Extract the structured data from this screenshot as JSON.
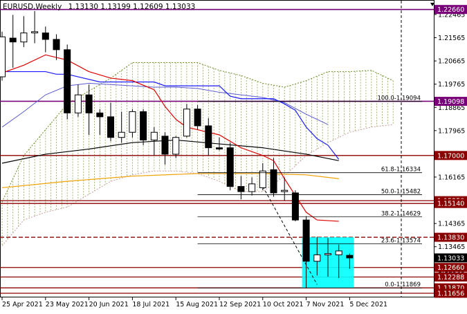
{
  "header": {
    "title": "EURUSD,Weekly",
    "ohlc": "1.13130 1.13199 1.12609 1.13033"
  },
  "colors": {
    "bull": "#ffffff",
    "bear": "#000000",
    "tenkan": "#e00000",
    "kijun": "#1a1aff",
    "chikou": "#5a5ad0",
    "ma_black": "#000000",
    "ma_orange": "#f0a000",
    "cloud_up": "#6b8e23",
    "cloud_down": "#c8a0a0",
    "level": "#8b0000",
    "purple": "#7a007a",
    "cyan": "#00ffff"
  },
  "chart_data": {
    "type": "candlestick",
    "symbol": "EURUSD",
    "timeframe": "Weekly",
    "ylim": [
      1.115,
      1.23
    ],
    "x_ticks": [
      {
        "i": 0,
        "label": "25 Apr 2021"
      },
      {
        "i": 4,
        "label": "23 May 2021"
      },
      {
        "i": 8,
        "label": "20 Jun 2021"
      },
      {
        "i": 12,
        "label": "18 Jul 2021"
      },
      {
        "i": 16,
        "label": "15 Aug 2021"
      },
      {
        "i": 20,
        "label": "12 Sep 2021"
      },
      {
        "i": 24,
        "label": "10 Oct 2021"
      },
      {
        "i": 28,
        "label": "7 Nov 2021"
      },
      {
        "i": 32,
        "label": "5 Dec 2021"
      }
    ],
    "y_ticks": [
      1.22465,
      1.21565,
      1.20665,
      1.19765,
      1.18865,
      1.17965,
      1.17065,
      1.16165,
      1.15265,
      1.14365,
      1.13465,
      1.12565,
      1.11665
    ],
    "candles": [
      {
        "o": 1.2005,
        "h": 1.218,
        "l": 1.199,
        "c": 1.216
      },
      {
        "o": 1.2155,
        "h": 1.2245,
        "l": 1.204,
        "c": 1.214
      },
      {
        "o": 1.214,
        "h": 1.224,
        "l": 1.212,
        "c": 1.2175
      },
      {
        "o": 1.2175,
        "h": 1.226,
        "l": 1.2135,
        "c": 1.218
      },
      {
        "o": 1.2175,
        "h": 1.22,
        "l": 1.21,
        "c": 1.215
      },
      {
        "o": 1.215,
        "h": 1.217,
        "l": 1.207,
        "c": 1.211
      },
      {
        "o": 1.211,
        "h": 1.213,
        "l": 1.184,
        "c": 1.1865
      },
      {
        "o": 1.1865,
        "h": 1.1975,
        "l": 1.185,
        "c": 1.1935
      },
      {
        "o": 1.1935,
        "h": 1.1975,
        "l": 1.178,
        "c": 1.1865
      },
      {
        "o": 1.1865,
        "h": 1.188,
        "l": 1.178,
        "c": 1.185
      },
      {
        "o": 1.185,
        "h": 1.1905,
        "l": 1.1755,
        "c": 1.177
      },
      {
        "o": 1.177,
        "h": 1.187,
        "l": 1.175,
        "c": 1.179
      },
      {
        "o": 1.179,
        "h": 1.188,
        "l": 1.177,
        "c": 1.187
      },
      {
        "o": 1.187,
        "h": 1.188,
        "l": 1.174,
        "c": 1.176
      },
      {
        "o": 1.176,
        "h": 1.181,
        "l": 1.17,
        "c": 1.179
      },
      {
        "o": 1.1775,
        "h": 1.179,
        "l": 1.1665,
        "c": 1.1705
      },
      {
        "o": 1.1705,
        "h": 1.1775,
        "l": 1.169,
        "c": 1.177
      },
      {
        "o": 1.1775,
        "h": 1.19,
        "l": 1.177,
        "c": 1.188
      },
      {
        "o": 1.188,
        "h": 1.1895,
        "l": 1.18,
        "c": 1.1815
      },
      {
        "o": 1.1815,
        "h": 1.1845,
        "l": 1.17,
        "c": 1.173
      },
      {
        "o": 1.173,
        "h": 1.177,
        "l": 1.172,
        "c": 1.1725
      },
      {
        "o": 1.173,
        "h": 1.175,
        "l": 1.1565,
        "c": 1.158
      },
      {
        "o": 1.158,
        "h": 1.162,
        "l": 1.153,
        "c": 1.156
      },
      {
        "o": 1.156,
        "h": 1.1615,
        "l": 1.1545,
        "c": 1.159
      },
      {
        "o": 1.1575,
        "h": 1.167,
        "l": 1.1565,
        "c": 1.164
      },
      {
        "o": 1.1645,
        "h": 1.169,
        "l": 1.154,
        "c": 1.1555
      },
      {
        "o": 1.156,
        "h": 1.1615,
        "l": 1.1525,
        "c": 1.1565
      },
      {
        "o": 1.1555,
        "h": 1.1565,
        "l": 1.1445,
        "c": 1.145
      },
      {
        "o": 1.145,
        "h": 1.1465,
        "l": 1.1185,
        "c": 1.129
      },
      {
        "o": 1.129,
        "h": 1.1385,
        "l": 1.1235,
        "c": 1.1315
      },
      {
        "o": 1.1315,
        "h": 1.138,
        "l": 1.123,
        "c": 1.132
      },
      {
        "o": 1.1315,
        "h": 1.1355,
        "l": 1.1225,
        "c": 1.133
      },
      {
        "o": 1.1313,
        "h": 1.132,
        "l": 1.1261,
        "c": 1.1303
      }
    ],
    "price_tags": [
      {
        "value": 1.2266,
        "label": "1.22660",
        "color": "#7a007a"
      },
      {
        "value": 1.191,
        "label": "1.19098",
        "color": "#7a007a"
      },
      {
        "value": 1.17,
        "label": "1.17000",
        "color": "#8b0000"
      },
      {
        "value": 1.1525,
        "label": "1.15250",
        "color": "#8b0000"
      },
      {
        "value": 1.1514,
        "label": "1.15140",
        "color": "#8b0000"
      },
      {
        "value": 1.1383,
        "label": "1.13830",
        "color": "#8b0000"
      },
      {
        "value": 1.1303,
        "label": "1.13033",
        "color": "#000000"
      },
      {
        "value": 1.1266,
        "label": "1.12660",
        "color": "#8b0000"
      },
      {
        "value": 1.1229,
        "label": "1.12288",
        "color": "#8b0000"
      },
      {
        "value": 1.1187,
        "label": "1.11870",
        "color": "#8b0000"
      },
      {
        "value": 1.1166,
        "label": "1.11656",
        "color": "#8b0000"
      }
    ],
    "fibo_levels": [
      {
        "value": 1.19094,
        "label": "100.0-1.19094"
      },
      {
        "value": 1.16334,
        "label": "61.8-1.16334"
      },
      {
        "value": 1.15482,
        "label": "50.0-1.15482"
      },
      {
        "value": 1.14629,
        "label": "38.2-1.14629"
      },
      {
        "value": 1.13574,
        "label": "23.6-1.13574"
      },
      {
        "value": 1.11869,
        "label": "0.0-1.11869"
      }
    ],
    "tenkan": [
      [
        0,
        1.202
      ],
      [
        2,
        1.205
      ],
      [
        4,
        1.209
      ],
      [
        5,
        1.208
      ],
      [
        6,
        1.207
      ],
      [
        8,
        1.2025
      ],
      [
        10,
        1.2
      ],
      [
        12,
        1.199
      ],
      [
        14,
        1.1955
      ],
      [
        15,
        1.189
      ],
      [
        16,
        1.184
      ],
      [
        17,
        1.181
      ],
      [
        18,
        1.18
      ],
      [
        20,
        1.178
      ],
      [
        22,
        1.173
      ],
      [
        24,
        1.17
      ],
      [
        25,
        1.168
      ],
      [
        26,
        1.161
      ],
      [
        27,
        1.1545
      ],
      [
        28,
        1.148
      ],
      [
        29,
        1.145
      ],
      [
        31,
        1.1445
      ]
    ],
    "kijun": [
      [
        0,
        1.2025
      ],
      [
        4,
        1.2025
      ],
      [
        5,
        1.2015
      ],
      [
        6,
        1.2015
      ],
      [
        9,
        1.1985
      ],
      [
        14,
        1.1985
      ],
      [
        15,
        1.197
      ],
      [
        20,
        1.197
      ],
      [
        21,
        1.193
      ],
      [
        22,
        1.192
      ],
      [
        25,
        1.192
      ],
      [
        26,
        1.19
      ],
      [
        27,
        1.1875
      ],
      [
        28,
        1.181
      ],
      [
        29,
        1.1765
      ],
      [
        30,
        1.174
      ],
      [
        31,
        1.1685
      ]
    ],
    "chikou": [
      [
        0,
        1.181
      ],
      [
        2,
        1.187
      ],
      [
        4,
        1.1935
      ],
      [
        6,
        1.197
      ],
      [
        8,
        1.198
      ],
      [
        10,
        1.1975
      ],
      [
        12,
        1.197
      ],
      [
        14,
        1.1965
      ],
      [
        16,
        1.1965
      ],
      [
        18,
        1.196
      ],
      [
        20,
        1.1945
      ],
      [
        22,
        1.1935
      ],
      [
        24,
        1.1925
      ],
      [
        26,
        1.1905
      ],
      [
        28,
        1.186
      ],
      [
        30,
        1.182
      ]
    ],
    "ma_black": [
      [
        0,
        1.167
      ],
      [
        4,
        1.1705
      ],
      [
        8,
        1.1725
      ],
      [
        12,
        1.175
      ],
      [
        16,
        1.176
      ],
      [
        20,
        1.1745
      ],
      [
        24,
        1.173
      ],
      [
        28,
        1.1705
      ],
      [
        31,
        1.168
      ]
    ],
    "ma_orange": [
      [
        0,
        1.1575
      ],
      [
        6,
        1.16
      ],
      [
        12,
        1.162
      ],
      [
        18,
        1.163
      ],
      [
        24,
        1.163
      ],
      [
        28,
        1.1625
      ],
      [
        31,
        1.161
      ]
    ],
    "senkou_a": [
      [
        0,
        1.152
      ],
      [
        2,
        1.17
      ],
      [
        4,
        1.18
      ],
      [
        6,
        1.19
      ],
      [
        8,
        1.195
      ],
      [
        10,
        1.2
      ],
      [
        12,
        1.206
      ],
      [
        14,
        1.206
      ],
      [
        16,
        1.206
      ],
      [
        18,
        1.206
      ],
      [
        20,
        1.203
      ],
      [
        22,
        1.201
      ],
      [
        24,
        1.198
      ],
      [
        26,
        1.1965
      ],
      [
        28,
        1.199
      ],
      [
        30,
        1.2025
      ],
      [
        32,
        1.2025
      ],
      [
        34,
        1.203
      ],
      [
        36,
        1.199
      ]
    ],
    "senkou_b": [
      [
        0,
        1.135
      ],
      [
        2,
        1.145
      ],
      [
        4,
        1.148
      ],
      [
        6,
        1.15
      ],
      [
        8,
        1.155
      ],
      [
        10,
        1.16
      ],
      [
        12,
        1.1625
      ],
      [
        14,
        1.164
      ],
      [
        16,
        1.164
      ],
      [
        18,
        1.163
      ],
      [
        20,
        1.16
      ],
      [
        22,
        1.156
      ],
      [
        24,
        1.156
      ],
      [
        26,
        1.162
      ],
      [
        28,
        1.17
      ],
      [
        30,
        1.175
      ],
      [
        32,
        1.179
      ],
      [
        34,
        1.181
      ],
      [
        36,
        1.182
      ]
    ],
    "future_cloud_a": [
      [
        28,
        1.199
      ],
      [
        30,
        1.2025
      ],
      [
        32,
        1.2025
      ],
      [
        34,
        1.203
      ],
      [
        36,
        1.199
      ]
    ],
    "future_cloud_b": [
      [
        28,
        1.17
      ],
      [
        30,
        1.175
      ],
      [
        32,
        1.179
      ],
      [
        34,
        1.181
      ],
      [
        36,
        1.183
      ]
    ],
    "cyan_box": {
      "x0": 28,
      "x1": 32,
      "y0": 1.1383,
      "y1": 1.1187
    },
    "dashed_trend": [
      [
        24,
        1.158
      ],
      [
        29,
        1.12
      ]
    ],
    "current_price": 1.1303
  }
}
